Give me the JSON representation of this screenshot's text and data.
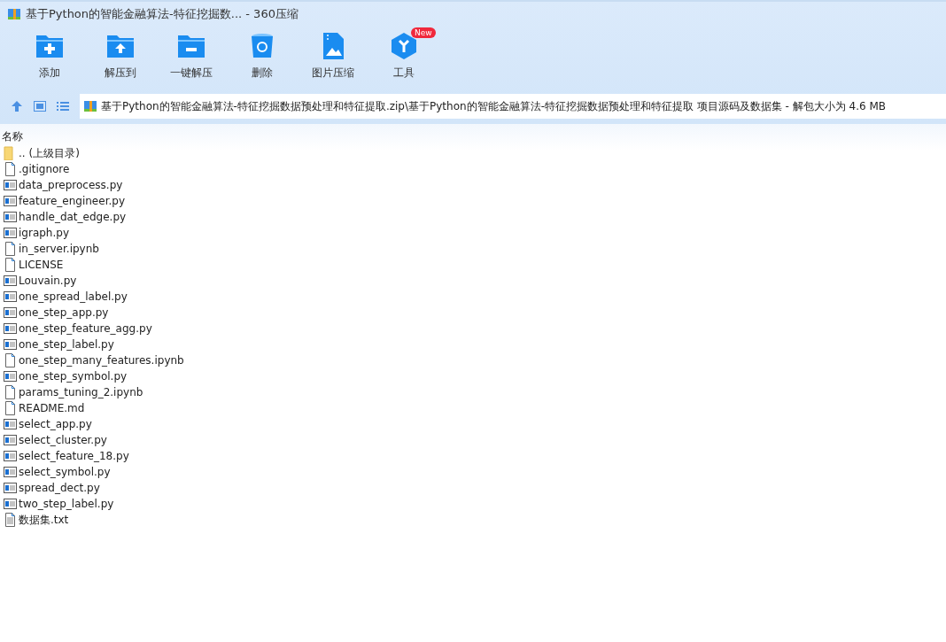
{
  "window": {
    "title": "基于Python的智能金融算法-特征挖掘数... - 360压缩"
  },
  "toolbar": [
    {
      "kind": "add",
      "label": "添加"
    },
    {
      "kind": "extract-to",
      "label": "解压到"
    },
    {
      "kind": "extract",
      "label": "一键解压"
    },
    {
      "kind": "delete",
      "label": "删除"
    },
    {
      "kind": "image",
      "label": "图片压缩"
    },
    {
      "kind": "tools",
      "label": "工具",
      "badge": "New"
    }
  ],
  "address": {
    "path": "基于Python的智能金融算法-特征挖掘数据预处理和特征提取.zip\\基于Python的智能金融算法-特征挖掘数据预处理和特征提取 项目源码及数据集 - 解包大小为 4.6 MB"
  },
  "table": {
    "columns": [
      "名称"
    ],
    "rows": [
      {
        "kind": "folder",
        "name": ".. (上级目录)"
      },
      {
        "kind": "file",
        "name": ".gitignore"
      },
      {
        "kind": "py",
        "name": "data_preprocess.py"
      },
      {
        "kind": "py",
        "name": "feature_engineer.py"
      },
      {
        "kind": "py",
        "name": "handle_dat_edge.py"
      },
      {
        "kind": "py",
        "name": "igraph.py"
      },
      {
        "kind": "file",
        "name": "in_server.ipynb"
      },
      {
        "kind": "file",
        "name": "LICENSE"
      },
      {
        "kind": "py",
        "name": "Louvain.py"
      },
      {
        "kind": "py",
        "name": "one_spread_label.py"
      },
      {
        "kind": "py",
        "name": "one_step_app.py"
      },
      {
        "kind": "py",
        "name": "one_step_feature_agg.py"
      },
      {
        "kind": "py",
        "name": "one_step_label.py"
      },
      {
        "kind": "file",
        "name": "one_step_many_features.ipynb"
      },
      {
        "kind": "py",
        "name": "one_step_symbol.py"
      },
      {
        "kind": "file",
        "name": "params_tuning_2.ipynb"
      },
      {
        "kind": "file",
        "name": "README.md"
      },
      {
        "kind": "py",
        "name": "select_app.py"
      },
      {
        "kind": "py",
        "name": "select_cluster.py"
      },
      {
        "kind": "py",
        "name": "select_feature_18.py"
      },
      {
        "kind": "py",
        "name": "select_symbol.py"
      },
      {
        "kind": "py",
        "name": "spread_dect.py"
      },
      {
        "kind": "py",
        "name": "two_step_label.py"
      },
      {
        "kind": "text",
        "name": "数据集.txt"
      }
    ]
  }
}
